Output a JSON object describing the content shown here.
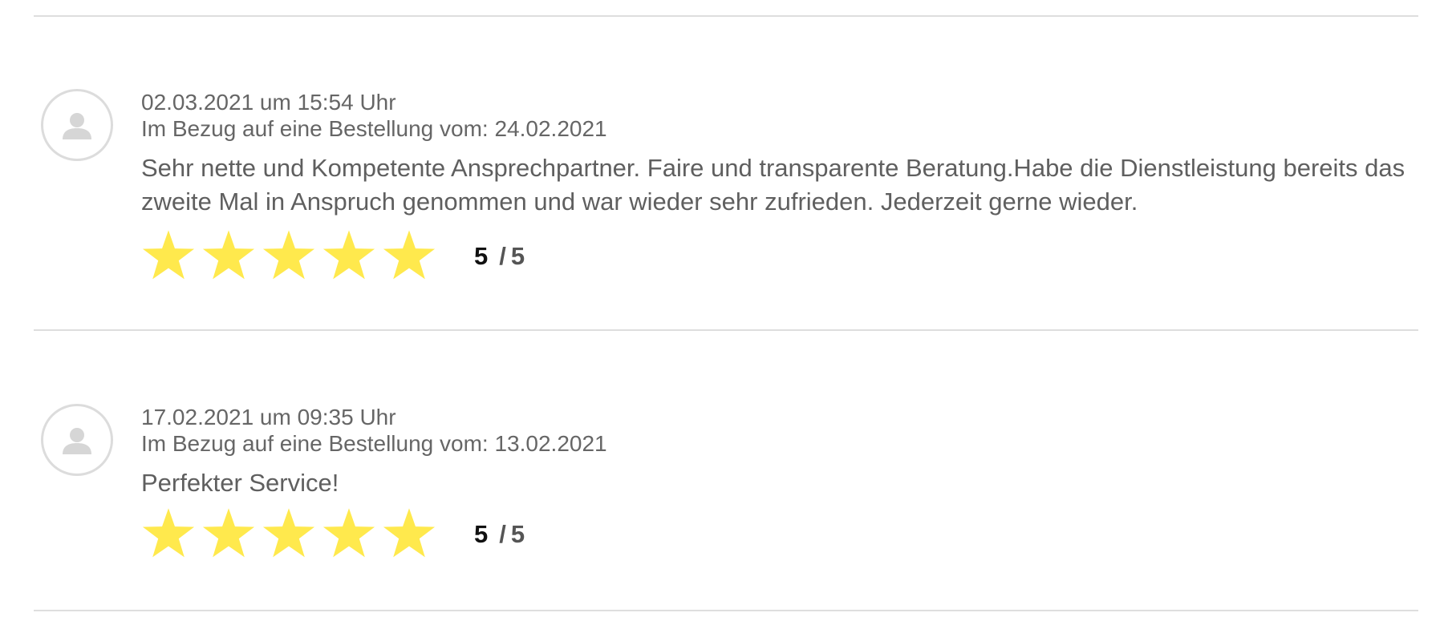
{
  "colors": {
    "star": "#ffe94d",
    "divider": "#dedede",
    "avatar_border": "#dcdcdc",
    "avatar_icon": "#d6d6d6"
  },
  "reviews": [
    {
      "avatar_icon": "user-icon",
      "date": "02.03.2021 um 15:54 Uhr",
      "order_ref": "Im Bezug auf eine Bestellung vom: 24.02.2021",
      "text": "Sehr nette und Kompetente Ansprechpartner. Faire und transparente Beratung.Habe die Dienstleistung bereits das zweite Mal in Anspruch genommen und war wieder sehr zufrieden. Jederzeit gerne wieder.",
      "rating": 5,
      "rating_value": "5",
      "rating_sep": "/",
      "rating_max": "5"
    },
    {
      "avatar_icon": "user-icon",
      "date": "17.02.2021 um 09:35 Uhr",
      "order_ref": "Im Bezug auf eine Bestellung vom: 13.02.2021",
      "text": "Perfekter Service!",
      "rating": 5,
      "rating_value": "5",
      "rating_sep": "/",
      "rating_max": "5"
    }
  ]
}
